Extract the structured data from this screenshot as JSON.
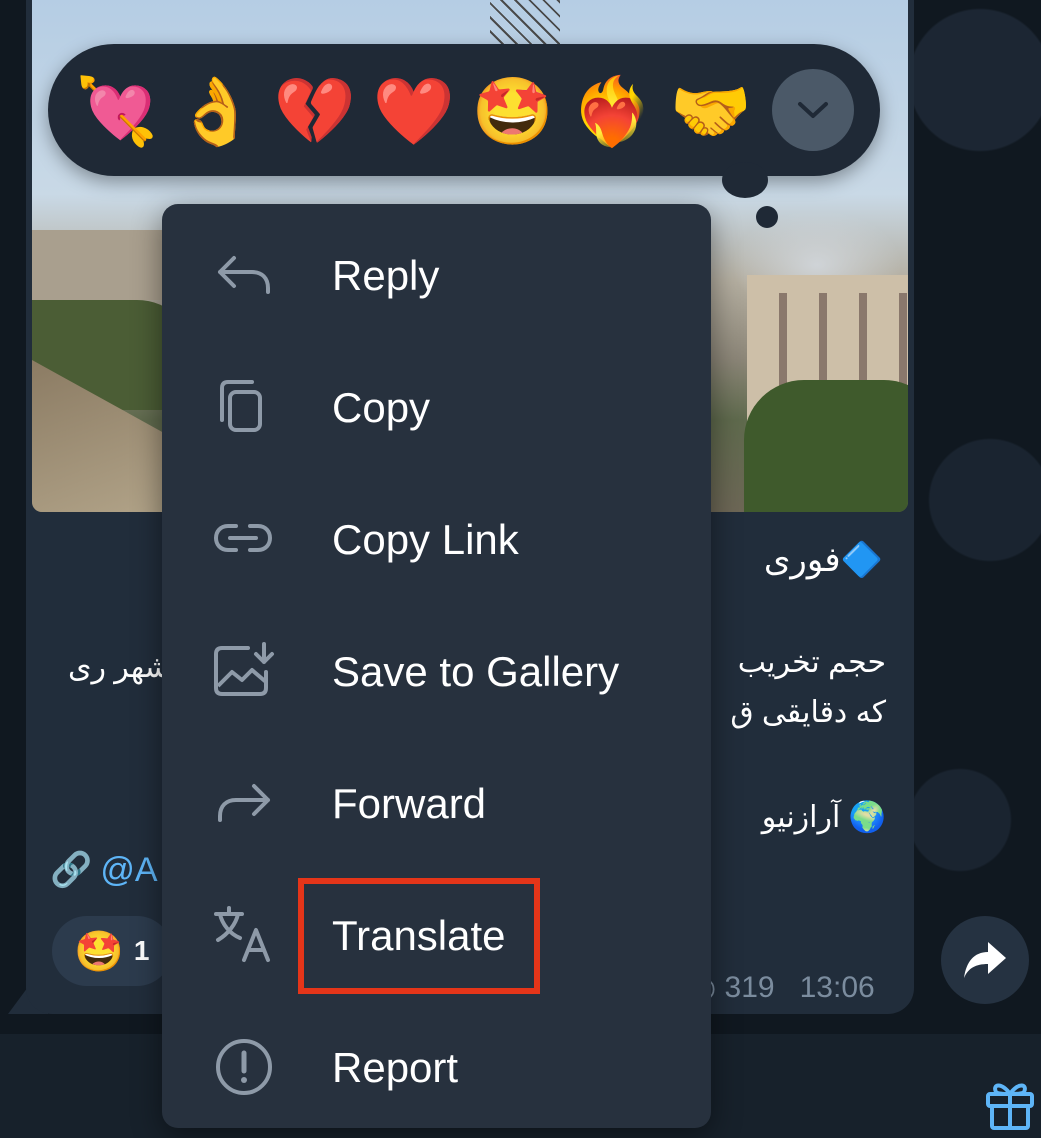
{
  "message": {
    "headline": "🔷فوری",
    "body_line1_right": "حجم تخریب",
    "body_line1_left": "شهر ری",
    "body_line2": "که دقایقی ق",
    "source_line": "🌍 آرازنیو",
    "link_prefix": "@A",
    "reaction_emoji": "🤩",
    "reaction_count": "1",
    "views": "319",
    "time": "13:06"
  },
  "reactions": {
    "items": [
      {
        "emoji": "💘",
        "name": "heart-with-arrow"
      },
      {
        "emoji": "👌",
        "name": "ok-hand"
      },
      {
        "emoji": "💔",
        "name": "broken-heart"
      },
      {
        "emoji": "❤️",
        "name": "red-heart"
      },
      {
        "emoji": "🤩",
        "name": "star-struck"
      },
      {
        "emoji": "❤️‍🔥",
        "name": "heart-on-fire"
      },
      {
        "emoji": "🤝",
        "name": "handshake"
      }
    ],
    "expand_icon": "chevron-down-icon"
  },
  "menu": {
    "items": [
      {
        "label": "Reply",
        "icon": "reply-icon"
      },
      {
        "label": "Copy",
        "icon": "copy-icon"
      },
      {
        "label": "Copy Link",
        "icon": "link-icon"
      },
      {
        "label": "Save to Gallery",
        "icon": "save-to-gallery-icon"
      },
      {
        "label": "Forward",
        "icon": "forward-icon"
      },
      {
        "label": "Translate",
        "icon": "translate-icon"
      },
      {
        "label": "Report",
        "icon": "report-icon"
      }
    ]
  },
  "colors": {
    "menu_bg": "#27313e",
    "highlight": "#e53519",
    "link": "#5eb5f7"
  }
}
